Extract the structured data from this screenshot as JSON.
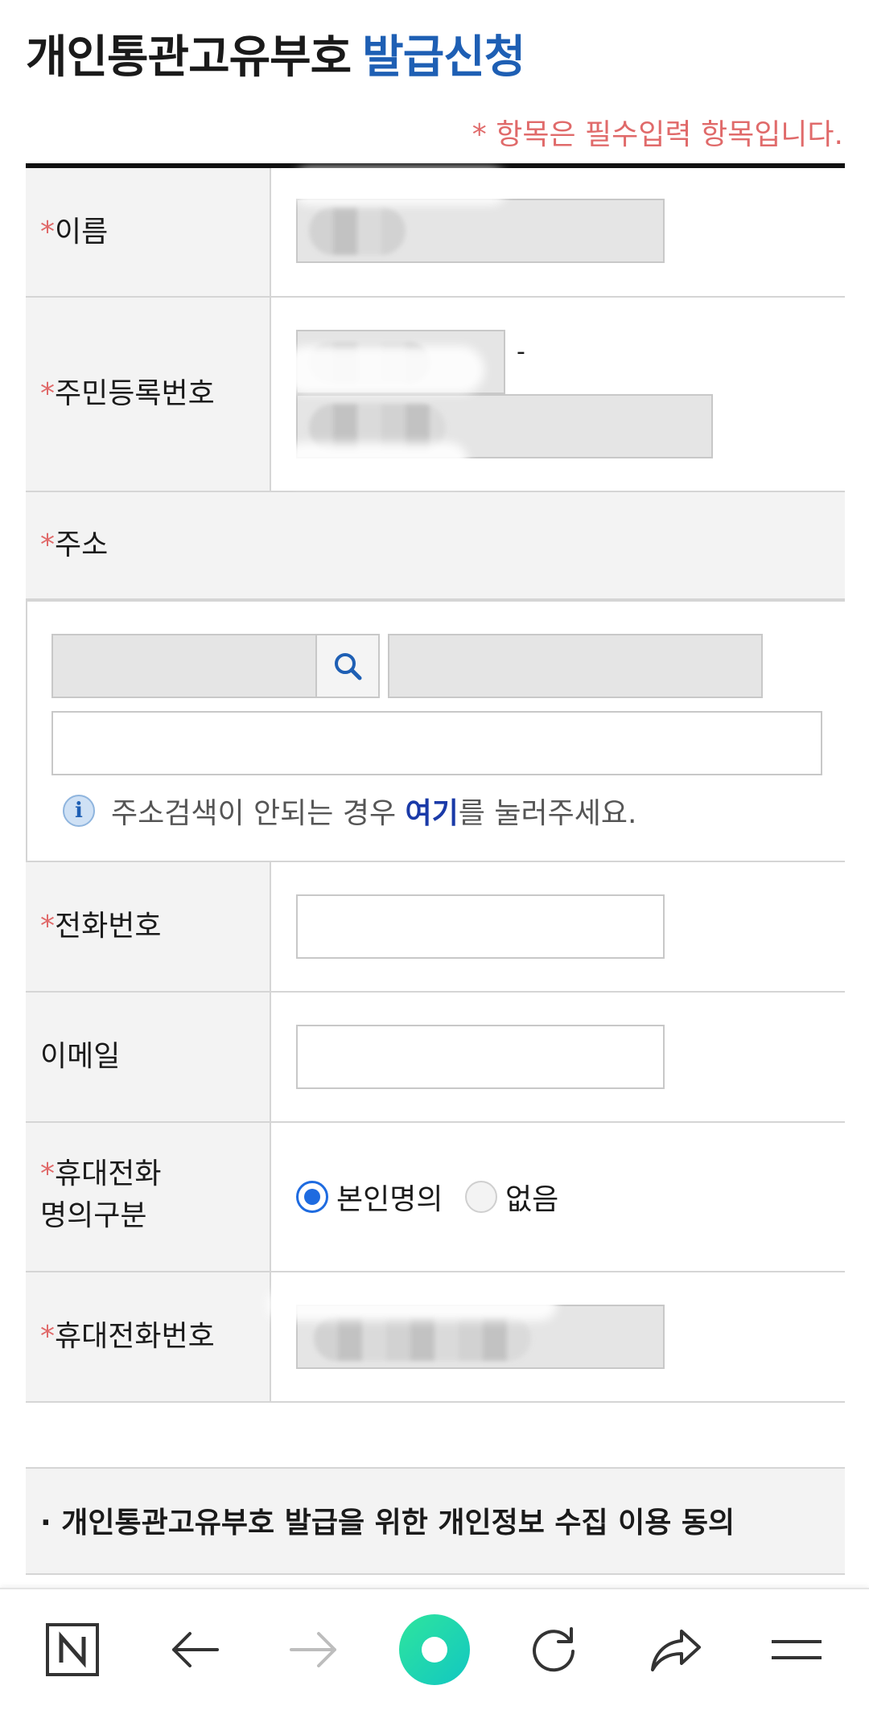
{
  "header": {
    "title_main": "개인통관고유부호",
    "title_accent": "발급신청",
    "required_note": "* 항목은 필수입력 항목입니다."
  },
  "form": {
    "star": "*",
    "name_label": "이름",
    "rrn_label": "주민등록번호",
    "rrn_separator": "-",
    "address_label": "주소",
    "address_help_before": "주소검색이 안되는 경우 ",
    "address_help_link": "여기",
    "address_help_after": "를 눌러주세요.",
    "phone_label": "전화번호",
    "email_label": "이메일",
    "mobile_owner_label_line1": "휴대전화",
    "mobile_owner_label_line2": "명의구분",
    "mobile_owner_options": [
      "본인명의",
      "없음"
    ],
    "mobile_owner_selected": "본인명의",
    "mobile_label": "휴대전화번호"
  },
  "consent": {
    "title": "· 개인통관고유부호 발급을 위한 개인정보 수집 이용 동의"
  },
  "bottom_nav": {
    "items": [
      "naver-home-icon",
      "back-arrow-icon",
      "forward-arrow-icon",
      "green-dot-icon",
      "refresh-icon",
      "share-icon",
      "menu-icon"
    ]
  },
  "colors": {
    "accent": "#1e5fb4",
    "required": "#e06a6a",
    "radio": "#1e6be0"
  }
}
